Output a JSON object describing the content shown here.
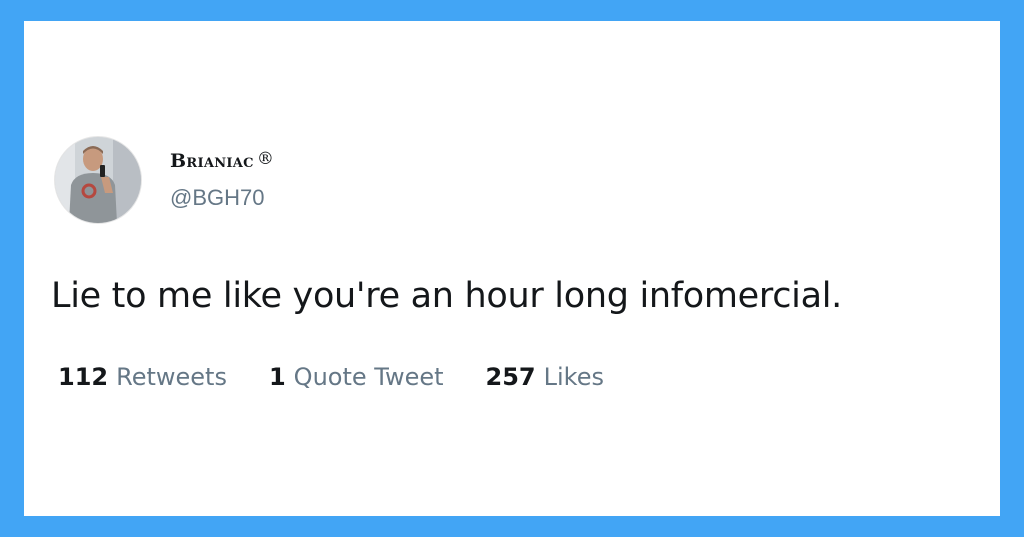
{
  "tweet": {
    "display_name": "Brianiac",
    "registered_mark": "®",
    "handle": "@BGH70",
    "text": "Lie to me like you're an hour long infomercial.",
    "stats": [
      {
        "count": "112",
        "label": "Retweets"
      },
      {
        "count": "1",
        "label": "Quote Tweet"
      },
      {
        "count": "257",
        "label": "Likes"
      }
    ]
  },
  "colors": {
    "background": "#42a5f5",
    "card": "#ffffff",
    "text_primary": "#14171a",
    "text_secondary": "#657786"
  },
  "icons": [
    "avatar"
  ]
}
